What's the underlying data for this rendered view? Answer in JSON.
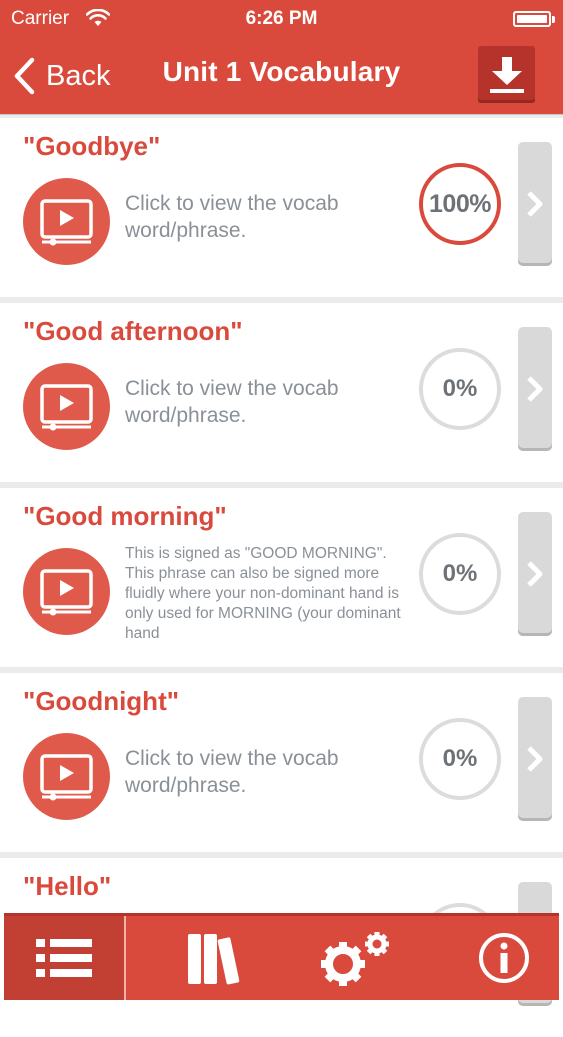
{
  "status_bar": {
    "carrier": "Carrier",
    "time": "6:26 PM"
  },
  "nav": {
    "back_label": "Back",
    "title": "Unit 1 Vocabulary",
    "download_icon": "download-arrow-icon"
  },
  "items": [
    {
      "word": "\"Goodbye\"",
      "description": "Click to view the vocab word/phrase.",
      "progress_label": "100%",
      "progress": 1.0
    },
    {
      "word": "\"Good afternoon\"",
      "description": "Click to view the vocab word/phrase.",
      "progress_label": "0%",
      "progress": 0
    },
    {
      "word": "\"Good morning\"",
      "description": "This is signed as \"GOOD MORNING\". This phrase can also be signed more fluidly where your non-dominant hand is only used for MORNING (your dominant hand",
      "progress_label": "0%",
      "progress": 0
    },
    {
      "word": "\"Goodnight\"",
      "description": "Click to view the vocab word/phrase.",
      "progress_label": "0%",
      "progress": 0
    },
    {
      "word": "\"Hello\"",
      "description": "",
      "progress_label": "",
      "progress": 0
    }
  ],
  "tabs": [
    {
      "name": "list",
      "icon": "list-icon",
      "active": true
    },
    {
      "name": "library",
      "icon": "books-icon",
      "active": false
    },
    {
      "name": "settings",
      "icon": "gears-icon",
      "active": false
    },
    {
      "name": "info",
      "icon": "info-icon",
      "active": false
    }
  ],
  "colors": {
    "accent": "#d94a3d",
    "accent_dark": "#b5332a",
    "text_muted": "#8a9097",
    "progress_ring": "#dcdcdc"
  }
}
